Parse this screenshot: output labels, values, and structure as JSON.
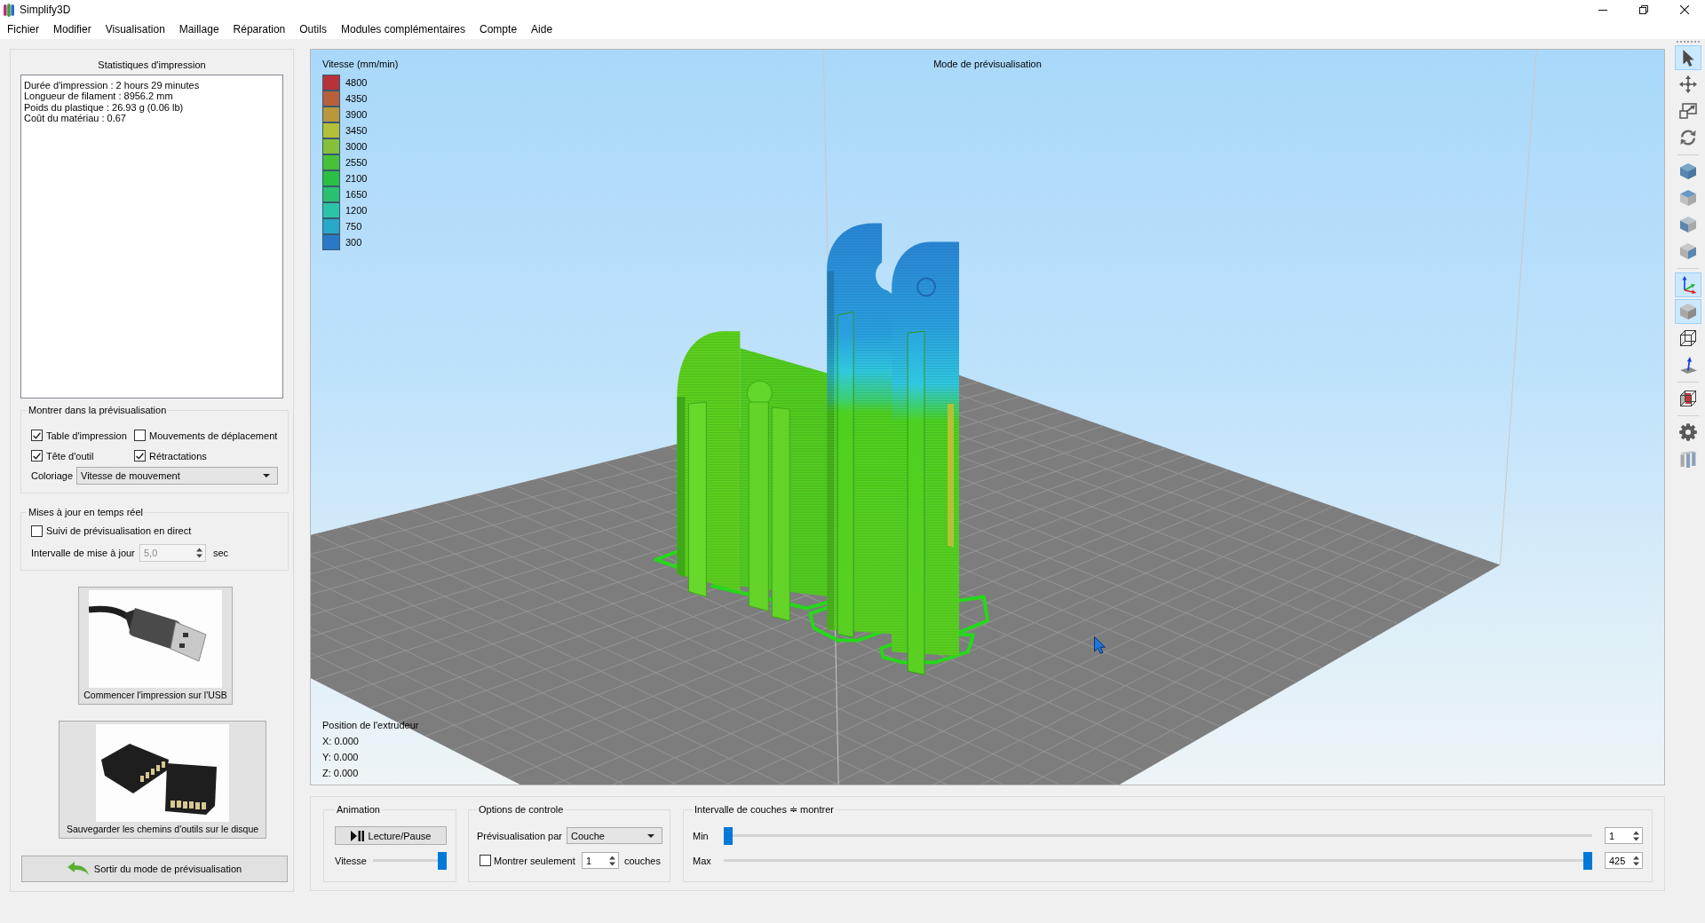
{
  "window": {
    "title": "Simplify3D"
  },
  "menu": [
    "Fichier",
    "Modifier",
    "Visualisation",
    "Maillage",
    "Réparation",
    "Outils",
    "Modules complémentaires",
    "Compte",
    "Aide"
  ],
  "left_panel": {
    "statistics": {
      "title": "Statistiques d'impression",
      "lines": [
        "Durée d'impression : 2 hours 29 minutes",
        "Longueur de filament : 8956.2 mm",
        "Poids du plastique : 26.93 g (0.06 lb)",
        "Coût du matériau : 0.67"
      ]
    },
    "show_in_preview": {
      "title": "Montrer dans la prévisualisation",
      "options": [
        {
          "label": "Table d'impression",
          "checked": true
        },
        {
          "label": "Mouvements de déplacement",
          "checked": false
        },
        {
          "label": "Tête d'outil",
          "checked": true
        },
        {
          "label": "Rétractations",
          "checked": true
        }
      ],
      "coloring": {
        "label": "Coloriage",
        "value": "Vitesse de mouvement"
      }
    },
    "realtime_updates": {
      "title": "Mises à jour en temps réel",
      "live_tracking": {
        "label": "Suivi de prévisualisation en direct",
        "checked": false
      },
      "interval": {
        "label": "Intervalle de mise à jour",
        "value": "5,0",
        "disabled": true,
        "unit": "sec"
      }
    },
    "actions": [
      {
        "kind": "usb",
        "label": "Commencer l'impression sur l'USB"
      },
      {
        "kind": "sd",
        "label": "Sauvegarder les chemins d'outils sur le disque"
      }
    ],
    "exit_button": "Sortir du mode de prévisualisation"
  },
  "viewport": {
    "title": "Mode de prévisualisation",
    "legend": {
      "title": "Vitesse (mm/min)",
      "entries": [
        {
          "value": "4800",
          "color": "#b8323a"
        },
        {
          "value": "4350",
          "color": "#b8603a"
        },
        {
          "value": "3900",
          "color": "#b8983a"
        },
        {
          "value": "3450",
          "color": "#b4c038"
        },
        {
          "value": "3000",
          "color": "#84c03a"
        },
        {
          "value": "2550",
          "color": "#48c038"
        },
        {
          "value": "2100",
          "color": "#2ac044"
        },
        {
          "value": "1650",
          "color": "#2ac070"
        },
        {
          "value": "1200",
          "color": "#2cc4a8"
        },
        {
          "value": "750",
          "color": "#2aa8c8"
        },
        {
          "value": "300",
          "color": "#2a78c8"
        }
      ]
    },
    "extruder_position": {
      "title": "Position de l'extrudeur",
      "lines": [
        "X: 0.000",
        "Y: 0.000",
        "Z: 0.000"
      ]
    }
  },
  "bottom_panel": {
    "animation": {
      "title": "Animation",
      "play_button": "Lecture/Pause",
      "speed": {
        "label": "Vitesse",
        "level": 1
      }
    },
    "controls": {
      "title": "Options de controle",
      "preview_by": {
        "label": "Prévisualisation par",
        "value": "Couche"
      },
      "show_only": {
        "label": "Montrer seulement",
        "checked": false,
        "value": "1",
        "unit": "couches"
      }
    },
    "layer_range": {
      "title": "Intervalle de couches ≑ montrer",
      "min": {
        "label": "Min",
        "level": 0,
        "value": "1"
      },
      "max": {
        "label": "Max",
        "level": 1,
        "value": "425"
      }
    }
  },
  "toolbar": {
    "groups": [
      [
        {
          "kind": "select",
          "selected": true
        },
        {
          "kind": "move",
          "selected": false
        },
        {
          "kind": "scale",
          "selected": false
        },
        {
          "kind": "rotate",
          "selected": false
        }
      ],
      [
        {
          "kind": "view-iso",
          "selected": false
        },
        {
          "kind": "view-top",
          "selected": false
        },
        {
          "kind": "view-front",
          "selected": false
        },
        {
          "kind": "view-side",
          "selected": false
        }
      ],
      [
        {
          "kind": "axes",
          "selected": true
        },
        {
          "kind": "solid",
          "selected": true
        },
        {
          "kind": "wireframe",
          "selected": false
        },
        {
          "kind": "normal",
          "selected": false
        }
      ],
      [
        {
          "kind": "section",
          "selected": false
        }
      ],
      [
        {
          "kind": "settings",
          "selected": false
        },
        {
          "kind": "pillars",
          "selected": false
        }
      ]
    ]
  }
}
